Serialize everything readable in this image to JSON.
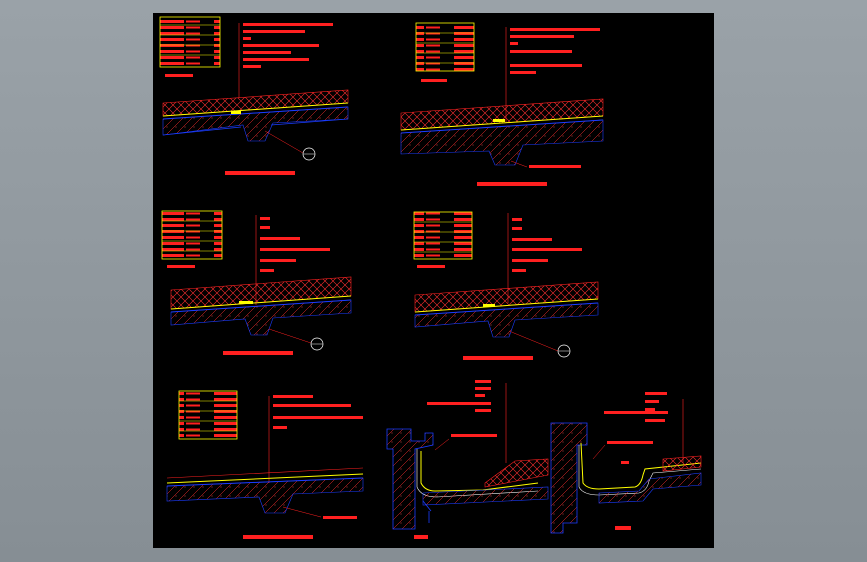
{
  "canvas": {
    "background": "#000000",
    "colors": {
      "red": "#ff2020",
      "yellow": "#ffff00",
      "blue": "#1a3cff",
      "white": "#ffffff",
      "hatch_red": "#ff3030",
      "callout_circle": "#ffffff"
    }
  },
  "details": [
    {
      "id": "d1",
      "caption": "",
      "has_legend": true,
      "has_callout_circle": true
    },
    {
      "id": "d2",
      "caption": "",
      "has_legend": true,
      "has_callout_circle": false
    },
    {
      "id": "d3",
      "caption": "",
      "has_legend": true,
      "has_callout_circle": true
    },
    {
      "id": "d4",
      "caption": "",
      "has_legend": true,
      "has_callout_circle": true
    },
    {
      "id": "d5",
      "caption": "",
      "has_legend": true,
      "has_callout_circle": false
    },
    {
      "id": "d6",
      "caption": "",
      "has_legend": false,
      "has_callout_circle": false
    },
    {
      "id": "d7",
      "caption": "",
      "has_legend": false,
      "has_callout_circle": false
    }
  ]
}
